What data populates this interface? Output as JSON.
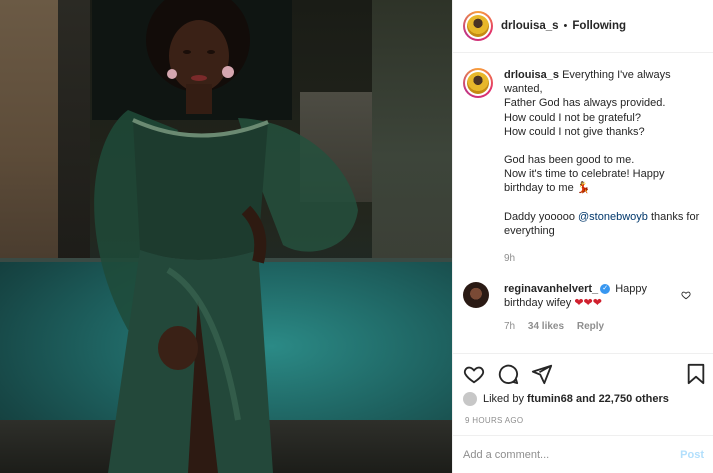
{
  "post": {
    "author": "drlouisa_s",
    "follow_status": "Following",
    "separator": "•",
    "caption_lines": [
      "Everything I've always wanted,",
      "Father God has always provided.",
      "How could I not be grateful?",
      "How could I not give thanks?",
      "",
      "God has been good to me.",
      "Now it's time to celebrate! Happy",
      "birthday to me 💃",
      "",
      "Daddy yooooo"
    ],
    "caption_mention": "@stonebwoyb",
    "caption_tail": "thanks for everything",
    "caption_age": "9h"
  },
  "comment": {
    "user": "reginavanhelvert_",
    "verified_mark": "✓",
    "text": "Happy birthday wifey",
    "emoji": "❤❤❤",
    "age": "7h",
    "likes": "34 likes",
    "reply": "Reply"
  },
  "likes": {
    "liked_by_prefix": "Liked by",
    "liked_by_user": "ftumin68",
    "others": "and 22,750 others"
  },
  "timestamp": "9 HOURS AGO",
  "add_comment": {
    "placeholder": "Add a comment...",
    "post_label": "Post"
  },
  "icons": {
    "like": "heart-icon",
    "comment": "comment-icon",
    "share": "share-icon",
    "save": "bookmark-icon"
  },
  "colors": {
    "link": "#00376b",
    "post_disabled": "#b2dffc",
    "verified": "#3897f0",
    "muted": "#8e8e8e"
  }
}
